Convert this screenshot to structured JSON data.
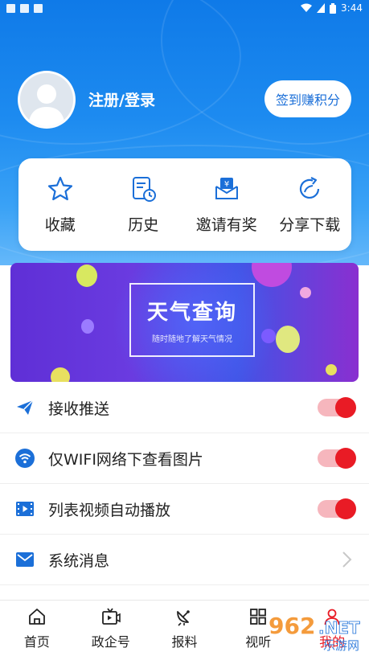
{
  "status_bar": {
    "time": "3:44"
  },
  "profile": {
    "login_label": "注册/登录",
    "signin_button": "签到赚积分"
  },
  "quick_actions": [
    {
      "label": "收藏",
      "icon": "star-icon"
    },
    {
      "label": "历史",
      "icon": "history-icon"
    },
    {
      "label": "邀请有奖",
      "icon": "invite-icon"
    },
    {
      "label": "分享下载",
      "icon": "share-icon"
    }
  ],
  "banner": {
    "title": "天气查询",
    "subtitle": "随时随地了解天气情况"
  },
  "settings": [
    {
      "label": "接收推送",
      "icon": "send-icon",
      "control": "toggle",
      "on": true
    },
    {
      "label": "仅WIFI网络下查看图片",
      "icon": "wifi-icon",
      "control": "toggle",
      "on": true
    },
    {
      "label": "列表视频自动播放",
      "icon": "video-icon",
      "control": "toggle",
      "on": true
    },
    {
      "label": "系统消息",
      "icon": "mail-icon",
      "control": "chevron"
    }
  ],
  "bottom_nav": [
    {
      "label": "首页",
      "icon": "home-icon"
    },
    {
      "label": "政企号",
      "icon": "tv-icon"
    },
    {
      "label": "报料",
      "icon": "satellite-dish-icon"
    },
    {
      "label": "视听",
      "icon": "grid-icon"
    },
    {
      "label": "我的",
      "icon": "user-icon"
    }
  ],
  "watermark": {
    "text": "962.NET",
    "subtext": "乐游网"
  },
  "colors": {
    "accent_blue": "#1b7ef0",
    "toggle_red": "#e91b25",
    "toggle_track": "#f6b6bd"
  }
}
